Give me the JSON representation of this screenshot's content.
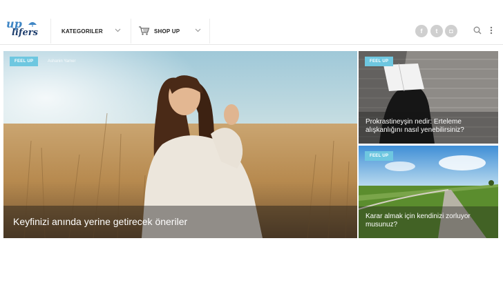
{
  "header": {
    "logo_top": "up",
    "logo_bottom": "lifers",
    "categories_label": "KATEGORILER",
    "shop_label": "SHOP UP",
    "social": [
      {
        "icon": "facebook-icon",
        "glyph": "f"
      },
      {
        "icon": "twitter-icon",
        "glyph": "t"
      },
      {
        "icon": "instagram-icon",
        "glyph": "◘"
      }
    ]
  },
  "hero": {
    "badge": "FEEL UP",
    "author": "Ashanin Yamer",
    "title": "Keyfinizi anında yerine getirecek öneriler"
  },
  "side": [
    {
      "badge": "FEEL UP",
      "title": "Prokrastineyşin nedir: Erteleme alışkanlığını nasıl yenebilirsiniz?"
    },
    {
      "badge": "FEEL UP",
      "title": "Karar almak için kendinizi zorluyor musunuz?"
    }
  ],
  "colors": {
    "accent": "#6ec7e0",
    "brand_blue": "#3f86c5",
    "brand_navy": "#1f3f6e"
  }
}
